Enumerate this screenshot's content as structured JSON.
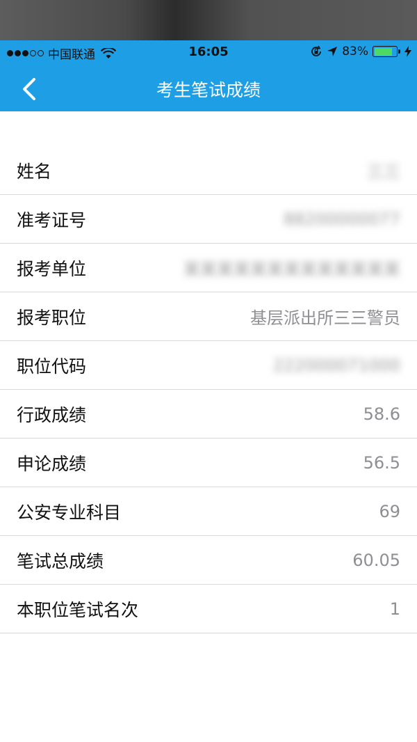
{
  "status_bar": {
    "carrier": "中国联通",
    "time": "16:05",
    "battery_percent_text": "83%",
    "battery_level": 0.83,
    "signal_bars_filled": 3,
    "signal_bars_total": 5,
    "icons": [
      "wifi-icon",
      "orientation-lock-icon",
      "location-arrow-icon",
      "battery-icon",
      "charging-bolt-icon"
    ]
  },
  "nav": {
    "title": "考生笔试成绩",
    "back_icon": "chevron-left-icon",
    "bg_color": "#1e9ee4"
  },
  "rows": [
    {
      "label": "姓名",
      "value": "三三"
    },
    {
      "label": "准考证号",
      "value": "88200000077"
    },
    {
      "label": "报考单位",
      "value": "某某某某某某某某某某某某某"
    },
    {
      "label": "报考职位",
      "value": "基层派出所三三警员"
    },
    {
      "label": "职位代码",
      "value": "222000071000"
    },
    {
      "label": "行政成绩",
      "value": "58.6"
    },
    {
      "label": "申论成绩",
      "value": "56.5"
    },
    {
      "label": "公安专业科目",
      "value": "69"
    },
    {
      "label": "笔试总成绩",
      "value": "60.05"
    },
    {
      "label": "本职位笔试名次",
      "value": "1"
    }
  ]
}
